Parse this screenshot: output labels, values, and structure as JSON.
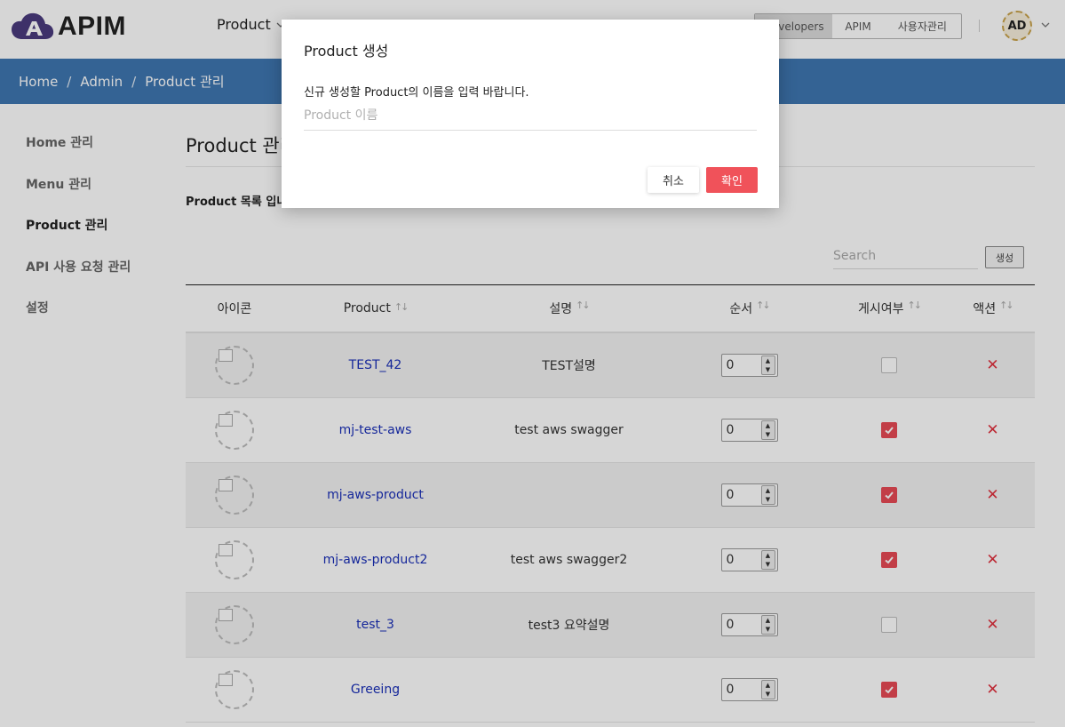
{
  "header": {
    "logo_text": "APIM",
    "nav_product": "Product",
    "segments": [
      "Developers",
      "APIM",
      "사용자관리"
    ],
    "avatar": "AD"
  },
  "breadcrumb": [
    "Home",
    "Admin",
    "Product 관리"
  ],
  "breadcrumb_sep": "/",
  "sidebar": {
    "items": [
      "Home 관리",
      "Menu 관리",
      "Product 관리",
      "API 사용 요청 관리",
      "설정"
    ],
    "active_index": 2
  },
  "main": {
    "title": "Product 관리",
    "subtitle": "Product 목록 입니다",
    "search_placeholder": "Search",
    "create_label": "생성"
  },
  "table": {
    "columns": [
      "아이콘",
      "Product",
      "설명",
      "순서",
      "게시여부",
      "액션"
    ],
    "sort_glyph": "↑↓",
    "rows": [
      {
        "product": "TEST_42",
        "description": "TEST설명",
        "order": "0",
        "published": false
      },
      {
        "product": "mj-test-aws",
        "description": "test aws swagger",
        "order": "0",
        "published": true
      },
      {
        "product": "mj-aws-product",
        "description": "",
        "order": "0",
        "published": true
      },
      {
        "product": "mj-aws-product2",
        "description": "test aws swagger2",
        "order": "0",
        "published": true
      },
      {
        "product": "test_3",
        "description": "test3 요약설명",
        "order": "0",
        "published": false
      },
      {
        "product": "Greeing",
        "description": "",
        "order": "0",
        "published": true
      }
    ],
    "delete_glyph": "✕"
  },
  "modal": {
    "title": "Product 생성",
    "message": "신규 생성할 Product의 이름을 입력 바랍니다.",
    "input_placeholder": "Product 이름",
    "cancel_label": "취소",
    "ok_label": "확인"
  },
  "colors": {
    "breadcrumb_bg": "#3f77b1",
    "accent_red": "#f0525a",
    "link_blue": "#1a2fb8",
    "logo_purple": "#4a3b7e"
  }
}
